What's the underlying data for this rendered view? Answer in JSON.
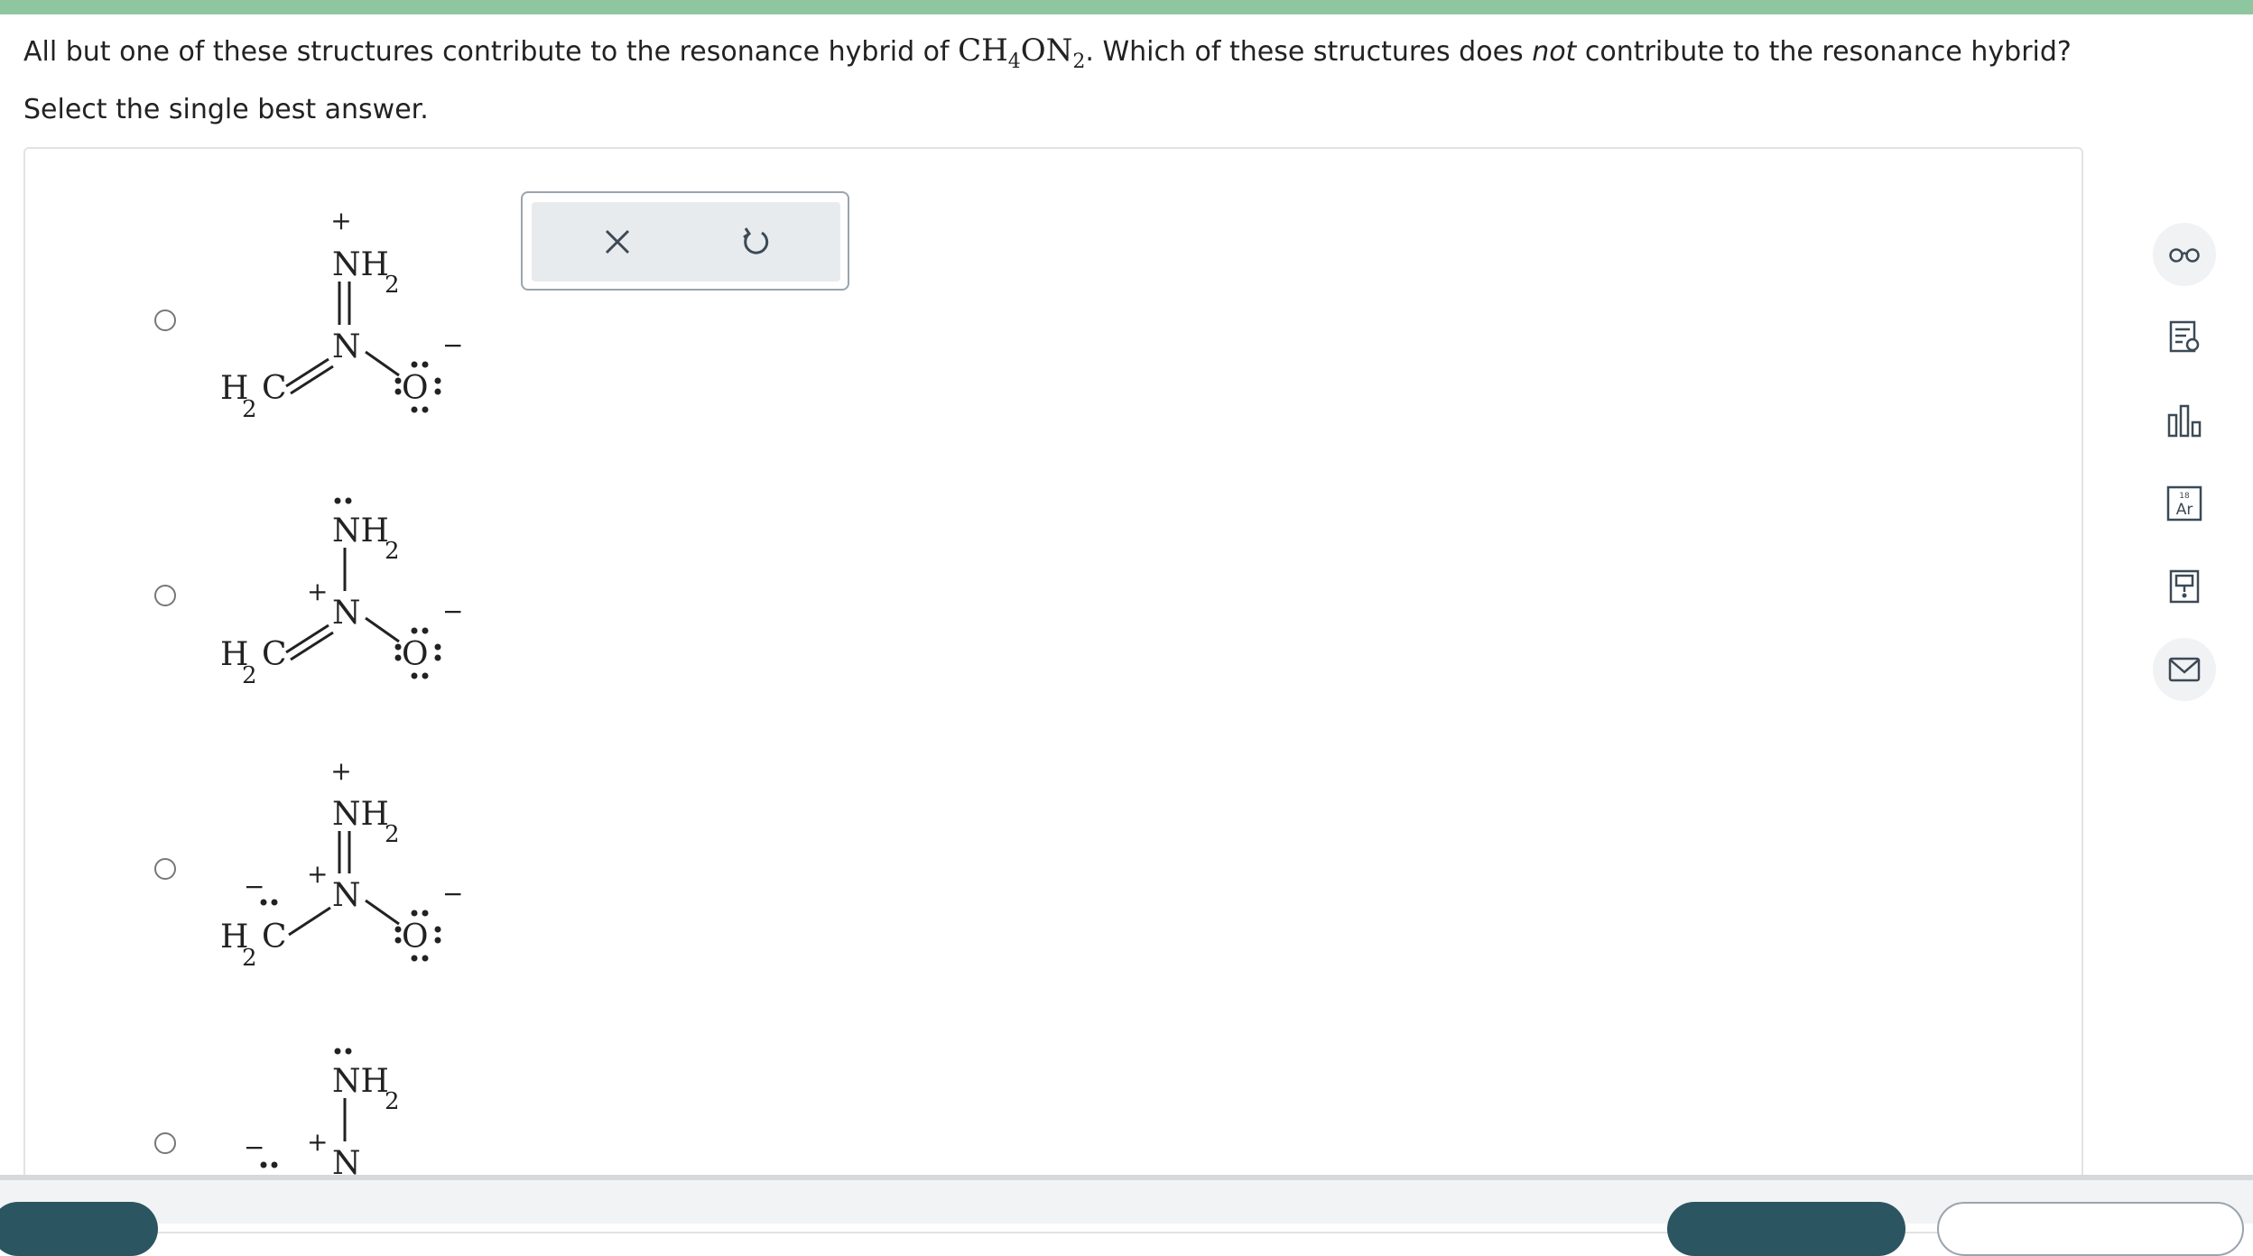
{
  "question": {
    "text_before": "All but one of these structures contribute to the resonance hybrid of ",
    "formula_c": "CH",
    "formula_sub1": "4",
    "formula_on": "ON",
    "formula_sub2": "2",
    "text_after_1": ". Which of these structures does ",
    "text_emphasis": "not",
    "text_after_2": " contribute to the resonance hybrid? Select the single best answer."
  },
  "structures": {
    "nh": "NH",
    "sub2": "2",
    "n": "N",
    "o": "O",
    "h": "H",
    "c": "C",
    "plus": "+",
    "minus": "−"
  },
  "options": [
    {
      "nh2_charge": "+",
      "n_charge": "",
      "c_charge": "",
      "cn_bond": "double",
      "nn_bond": "double"
    },
    {
      "nh2_charge": "lone-pair",
      "n_charge": "+",
      "c_charge": "",
      "cn_bond": "double",
      "nn_bond": "single"
    },
    {
      "nh2_charge": "+",
      "n_charge": "+",
      "c_charge": "−",
      "cn_bond": "single",
      "nn_bond": "double"
    },
    {
      "nh2_charge": "lone-pair",
      "n_charge": "+",
      "c_charge": "−",
      "cn_bond": "single",
      "nn_bond": "single"
    }
  ],
  "toolbox": {
    "clear_icon": "close-icon",
    "reset_icon": "undo-icon"
  },
  "sidebar": {
    "icons": [
      "glasses-icon",
      "notes-icon",
      "bar-chart-icon",
      "periodic-table-icon",
      "calculator-icon",
      "mail-icon"
    ],
    "periodic_number": "18",
    "periodic_symbol": "Ar"
  },
  "colors": {
    "accent": "#8ec79f",
    "button_dark": "#2b5561"
  }
}
